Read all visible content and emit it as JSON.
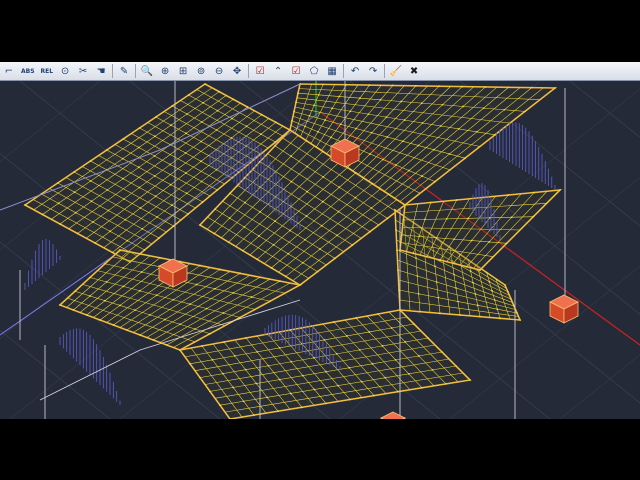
{
  "toolbar": {
    "abs_label": "ABS",
    "rel_label": "REL",
    "buttons": [
      {
        "name": "coordinate-axis-icon",
        "glyph": "⌐"
      },
      {
        "name": "abs-coordinates-button",
        "label_key": "abs"
      },
      {
        "name": "rel-coordinates-button",
        "label_key": "rel"
      },
      {
        "name": "capture-icon",
        "glyph": "⊙"
      },
      {
        "name": "cut-icon",
        "glyph": "✂"
      },
      {
        "name": "hand-icon",
        "glyph": "☚"
      },
      {
        "name": "sep"
      },
      {
        "name": "pencil-icon",
        "glyph": "✎"
      },
      {
        "name": "sep"
      },
      {
        "name": "zoom-icon",
        "glyph": "🔍"
      },
      {
        "name": "zoom-in-icon",
        "glyph": "⊕"
      },
      {
        "name": "zoom-window-icon",
        "glyph": "⊞"
      },
      {
        "name": "zoom-all-icon",
        "glyph": "⊚"
      },
      {
        "name": "zoom-out-icon",
        "glyph": "⊖"
      },
      {
        "name": "pan-icon",
        "glyph": "✥"
      },
      {
        "name": "sep"
      },
      {
        "name": "check-icon",
        "glyph": "☑"
      },
      {
        "name": "polyline-icon",
        "glyph": "⌃"
      },
      {
        "name": "select-icon",
        "glyph": "☑"
      },
      {
        "name": "pentagon-icon",
        "glyph": "⬠"
      },
      {
        "name": "grid-icon",
        "glyph": "▦"
      },
      {
        "name": "sep"
      },
      {
        "name": "undo-icon",
        "glyph": "↶"
      },
      {
        "name": "redo-icon",
        "glyph": "↷"
      },
      {
        "name": "sep"
      },
      {
        "name": "broom-icon",
        "glyph": "🧹"
      },
      {
        "name": "close-icon",
        "glyph": "✖"
      }
    ]
  },
  "colors": {
    "background": "#252a38",
    "mesh": "#f2d83a",
    "mesh_edge": "#e8a640",
    "load_hatch": "#5b5fd0",
    "support": "#d64a2a",
    "axis_x": "#d12020",
    "axis_y": "#1fb81f",
    "column_line": "#c8c8d8"
  }
}
